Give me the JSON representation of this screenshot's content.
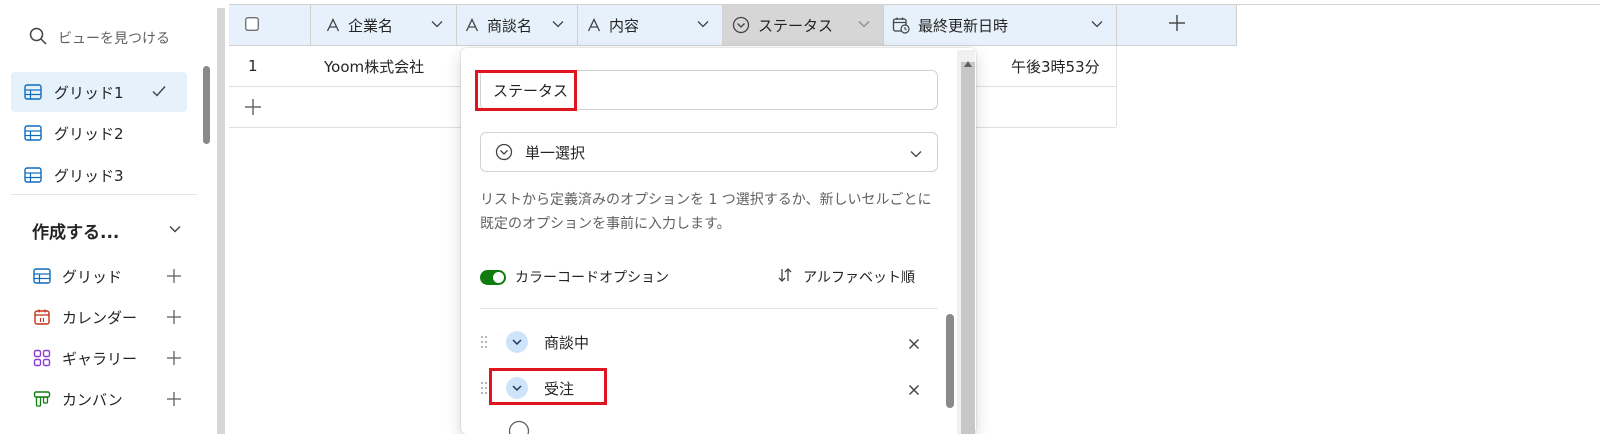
{
  "sidebar": {
    "search_placeholder": "ビューを見つける",
    "views": [
      {
        "label": "グリッド1",
        "active": true
      },
      {
        "label": "グリッド2",
        "active": false
      },
      {
        "label": "グリッド3",
        "active": false
      }
    ],
    "create_label": "作成する...",
    "create_items": [
      {
        "label": "グリッド",
        "icon": "grid-icon"
      },
      {
        "label": "カレンダー",
        "icon": "calendar-icon"
      },
      {
        "label": "ギャラリー",
        "icon": "gallery-icon"
      },
      {
        "label": "カンバン",
        "icon": "kanban-icon"
      }
    ]
  },
  "grid": {
    "columns": [
      {
        "label": "企業名",
        "icon": "text-column-icon"
      },
      {
        "label": "商談名",
        "icon": "text-column-icon"
      },
      {
        "label": "内容",
        "icon": "text-column-icon"
      },
      {
        "label": "ステータス",
        "icon": "choice-column-icon"
      },
      {
        "label": "最終更新日時",
        "icon": "datetime-column-icon"
      }
    ],
    "rows": [
      {
        "num": "1",
        "company": "Yoom株式会社",
        "updated": "午後3時53分"
      }
    ]
  },
  "popup": {
    "column_name": "ステータス",
    "column_type": "単一選択",
    "description": "リストから定義済みのオプションを 1 つ選択するか、新しいセルごとに既定のオプションを事前に入力します。",
    "color_code_label": "カラーコードオプション",
    "color_code_enabled": true,
    "sort_label": "アルファベット順",
    "options": [
      {
        "label": "商談中"
      },
      {
        "label": "受注"
      }
    ]
  },
  "colors": {
    "accent": "#0f6cbd",
    "toggle_on": "#107c10",
    "highlight": "#e0141e",
    "header_bg": "#e6f1fb"
  }
}
